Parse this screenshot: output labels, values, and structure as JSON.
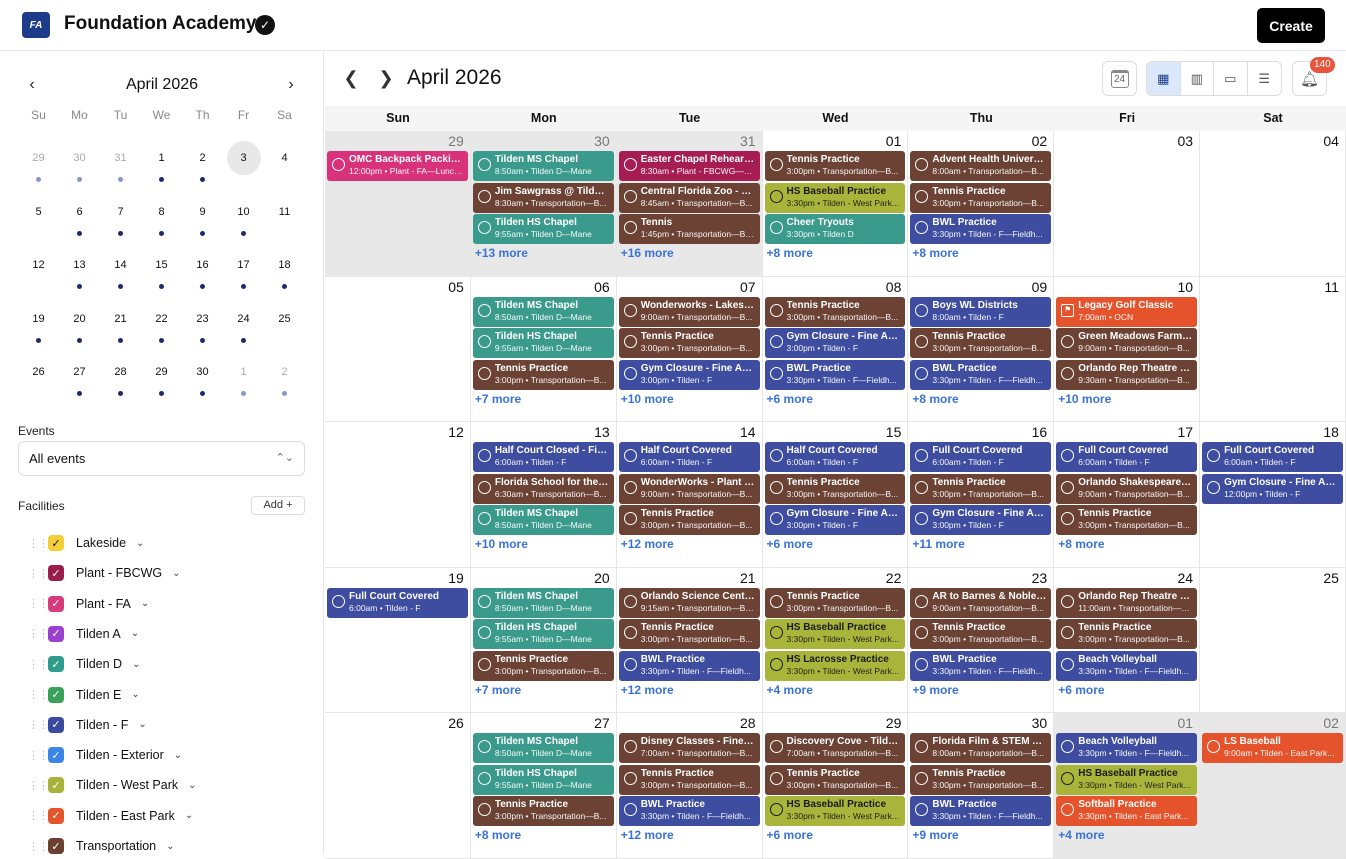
{
  "app": {
    "title": "Foundation Academy",
    "logo_text": "FA",
    "create_label": "Create"
  },
  "sidebar": {
    "month_title": "April 2026",
    "prev": "‹",
    "next": "›",
    "dow": [
      "Su",
      "Mo",
      "Tu",
      "We",
      "Th",
      "Fr",
      "Sa"
    ],
    "weeks": [
      [
        {
          "d": "29",
          "o": true,
          "dot": "light"
        },
        {
          "d": "30",
          "o": true,
          "dot": "light"
        },
        {
          "d": "31",
          "o": true,
          "dot": "light"
        },
        {
          "d": "1",
          "dot": "dark"
        },
        {
          "d": "2",
          "dot": "dark"
        },
        {
          "d": "3",
          "today": true
        },
        {
          "d": "4"
        }
      ],
      [
        {
          "d": "5"
        },
        {
          "d": "6",
          "dot": "dark"
        },
        {
          "d": "7",
          "dot": "dark"
        },
        {
          "d": "8",
          "dot": "dark"
        },
        {
          "d": "9",
          "dot": "dark"
        },
        {
          "d": "10",
          "dot": "dark"
        },
        {
          "d": "11"
        }
      ],
      [
        {
          "d": "12"
        },
        {
          "d": "13",
          "dot": "dark"
        },
        {
          "d": "14",
          "dot": "dark"
        },
        {
          "d": "15",
          "dot": "dark"
        },
        {
          "d": "16",
          "dot": "dark"
        },
        {
          "d": "17",
          "dot": "dark"
        },
        {
          "d": "18",
          "dot": "dark"
        }
      ],
      [
        {
          "d": "19",
          "dot": "dark"
        },
        {
          "d": "20",
          "dot": "dark"
        },
        {
          "d": "21",
          "dot": "dark"
        },
        {
          "d": "22",
          "dot": "dark"
        },
        {
          "d": "23",
          "dot": "dark"
        },
        {
          "d": "24",
          "dot": "dark"
        },
        {
          "d": "25"
        }
      ],
      [
        {
          "d": "26"
        },
        {
          "d": "27",
          "dot": "dark"
        },
        {
          "d": "28",
          "dot": "dark"
        },
        {
          "d": "29",
          "dot": "dark"
        },
        {
          "d": "30",
          "dot": "dark"
        },
        {
          "d": "1",
          "o": true,
          "dot": "light"
        },
        {
          "d": "2",
          "o": true,
          "dot": "light"
        }
      ]
    ],
    "events_label": "Events",
    "events_value": "All events",
    "facilities_label": "Facilities",
    "add_label": "Add +",
    "facilities": [
      {
        "name": "Lakeside",
        "color": "#f3cf3a",
        "dark": true
      },
      {
        "name": "Plant - FBCWG",
        "color": "#9b1b4b"
      },
      {
        "name": "Plant - FA",
        "color": "#d63a7a"
      },
      {
        "name": "Tilden A",
        "color": "#9b3fd1"
      },
      {
        "name": "Tilden D",
        "color": "#2f9b8a"
      },
      {
        "name": "Tilden E",
        "color": "#3aa05a"
      },
      {
        "name": "Tilden - F",
        "color": "#3b4a9e"
      },
      {
        "name": "Tilden - Exterior",
        "color": "#3a86e8"
      },
      {
        "name": "Tilden - West Park",
        "color": "#a7b23a"
      },
      {
        "name": "Tilden - East Park",
        "color": "#e5552b"
      },
      {
        "name": "Transportation",
        "color": "#6a4030"
      }
    ]
  },
  "calendar": {
    "title": "April 2026",
    "today_icon": "24",
    "notif_count": "140",
    "dow": [
      "Sun",
      "Mon",
      "Tue",
      "Wed",
      "Thu",
      "Fri",
      "Sat"
    ],
    "colors": {
      "teal": "#3a9a8c",
      "brown": "#6b4234",
      "blue": "#3e4d9f",
      "olive": "#a9b53a",
      "pink": "#d8337a",
      "maroon": "#a51d52",
      "orange": "#e5532c"
    },
    "weeks": [
      [
        {
          "d": "29",
          "o": true,
          "events": [
            {
              "t": "OMC Backpack Packing ...",
              "s": "12:00pm • Plant - FA—Lunch...",
              "c": "pink"
            }
          ]
        },
        {
          "d": "30",
          "o": true,
          "events": [
            {
              "t": "Tilden MS Chapel",
              "s": "8:50am • Tilden D—Mane",
              "c": "teal"
            },
            {
              "t": "Jim Sawgrass @ Tilden (...",
              "s": "8:30am • Transportation—B...",
              "c": "brown"
            },
            {
              "t": "Tilden HS Chapel",
              "s": "9:55am • Tilden D—Mane",
              "c": "teal"
            }
          ],
          "more": "+13 more"
        },
        {
          "d": "31",
          "o": true,
          "events": [
            {
              "t": "Easter Chapel Rehearsal",
              "s": "8:30am • Plant - FBCWG—S...",
              "c": "maroon"
            },
            {
              "t": "Central Florida Zoo - Plan...",
              "s": "8:45am • Transportation—B...",
              "c": "brown"
            },
            {
              "t": "Tennis",
              "s": "1:45pm • Transportation—Bu...",
              "c": "brown"
            }
          ],
          "more": "+16 more"
        },
        {
          "d": "01",
          "events": [
            {
              "t": "Tennis Practice",
              "s": "3:00pm • Transportation—B...",
              "c": "brown"
            },
            {
              "t": "HS Baseball Practice",
              "s": "3:30pm • Tilden - West Park...",
              "c": "olive",
              "dark": true
            },
            {
              "t": "Cheer Tryouts",
              "s": "3:30pm • Tilden D",
              "c": "teal"
            }
          ],
          "more": "+8 more"
        },
        {
          "d": "02",
          "events": [
            {
              "t": "Advent Health University...",
              "s": "8:00am • Transportation—B...",
              "c": "brown"
            },
            {
              "t": "Tennis Practice",
              "s": "3:00pm • Transportation—B...",
              "c": "brown"
            },
            {
              "t": "BWL Practice",
              "s": "3:30pm • Tilden - F—Fieldh...",
              "c": "blue"
            }
          ],
          "more": "+8 more"
        },
        {
          "d": "03",
          "events": []
        },
        {
          "d": "04",
          "events": []
        }
      ],
      [
        {
          "d": "05",
          "events": []
        },
        {
          "d": "06",
          "events": [
            {
              "t": "Tilden MS Chapel",
              "s": "8:50am • Tilden D—Mane",
              "c": "teal"
            },
            {
              "t": "Tilden HS Chapel",
              "s": "9:55am • Tilden D—Mane",
              "c": "teal"
            },
            {
              "t": "Tennis Practice",
              "s": "3:00pm • Transportation—B...",
              "c": "brown"
            }
          ],
          "more": "+7 more"
        },
        {
          "d": "07",
          "events": [
            {
              "t": "Wonderworks - Lakeside...",
              "s": "9:00am • Transportation—B...",
              "c": "brown"
            },
            {
              "t": "Tennis Practice",
              "s": "3:00pm • Transportation—B...",
              "c": "brown"
            },
            {
              "t": "Gym Closure - Fine Arts ...",
              "s": "3:00pm • Tilden - F",
              "c": "blue"
            }
          ],
          "more": "+10 more"
        },
        {
          "d": "08",
          "events": [
            {
              "t": "Tennis Practice",
              "s": "3:00pm • Transportation—B...",
              "c": "brown"
            },
            {
              "t": "Gym Closure - Fine Arts ...",
              "s": "3:00pm • Tilden - F",
              "c": "blue"
            },
            {
              "t": "BWL Practice",
              "s": "3:30pm • Tilden - F—Fieldh...",
              "c": "blue"
            }
          ],
          "more": "+6 more"
        },
        {
          "d": "09",
          "events": [
            {
              "t": "Boys WL Districts",
              "s": "8:00am • Tilden - F",
              "c": "blue"
            },
            {
              "t": "Tennis Practice",
              "s": "3:00pm • Transportation—B...",
              "c": "brown"
            },
            {
              "t": "BWL Practice",
              "s": "3:30pm • Tilden - F—Fieldh...",
              "c": "blue"
            }
          ],
          "more": "+8 more"
        },
        {
          "d": "10",
          "events": [
            {
              "t": "Legacy Golf Classic",
              "s": "7:00am • OCN",
              "c": "orange",
              "flag": true
            },
            {
              "t": "Green Meadows Farm - L...",
              "s": "9:00am • Transportation—B...",
              "c": "brown"
            },
            {
              "t": "Orlando Rep Theatre - Pl...",
              "s": "9:30am • Transportation—B...",
              "c": "brown"
            }
          ],
          "more": "+10 more"
        },
        {
          "d": "11",
          "events": []
        }
      ],
      [
        {
          "d": "12",
          "events": []
        },
        {
          "d": "13",
          "events": [
            {
              "t": "Half Court Closed - Fine ...",
              "s": "6:00am • Tilden - F",
              "c": "blue"
            },
            {
              "t": "Florida School for the De...",
              "s": "6:30am • Transportation—B...",
              "c": "brown"
            },
            {
              "t": "Tilden MS Chapel",
              "s": "8:50am • Tilden D—Mane",
              "c": "teal"
            }
          ],
          "more": "+10 more"
        },
        {
          "d": "14",
          "events": [
            {
              "t": "Half Court Covered",
              "s": "6:00am • Tilden - F",
              "c": "blue"
            },
            {
              "t": "WonderWorks - Plant Ho...",
              "s": "9:00am • Transportation—B...",
              "c": "brown"
            },
            {
              "t": "Tennis Practice",
              "s": "3:00pm • Transportation—B...",
              "c": "brown"
            }
          ],
          "more": "+12 more"
        },
        {
          "d": "15",
          "events": [
            {
              "t": "Half Court Covered",
              "s": "6:00am • Tilden - F",
              "c": "blue"
            },
            {
              "t": "Tennis Practice",
              "s": "3:00pm • Transportation—B...",
              "c": "brown"
            },
            {
              "t": "Gym Closure - Fine Arts ...",
              "s": "3:00pm • Tilden - F",
              "c": "blue"
            }
          ],
          "more": "+6 more"
        },
        {
          "d": "16",
          "events": [
            {
              "t": "Full Court Covered",
              "s": "6:00am • Tilden - F",
              "c": "blue"
            },
            {
              "t": "Tennis Practice",
              "s": "3:00pm • Transportation—B...",
              "c": "brown"
            },
            {
              "t": "Gym Closure - Fine Arts ...",
              "s": "3:00pm • Tilden - F",
              "c": "blue"
            }
          ],
          "more": "+11 more"
        },
        {
          "d": "17",
          "events": [
            {
              "t": "Full Court Covered",
              "s": "6:00am • Tilden - F",
              "c": "blue"
            },
            {
              "t": "Orlando Shakespeare Th...",
              "s": "9:00am • Transportation—B...",
              "c": "brown"
            },
            {
              "t": "Tennis Practice",
              "s": "3:00pm • Transportation—B...",
              "c": "brown"
            }
          ],
          "more": "+8 more"
        },
        {
          "d": "18",
          "events": [
            {
              "t": "Full Court Covered",
              "s": "6:00am • Tilden - F",
              "c": "blue"
            },
            {
              "t": "Gym Closure - Fine Arts ...",
              "s": "12:00pm • Tilden - F",
              "c": "blue"
            }
          ]
        }
      ],
      [
        {
          "d": "19",
          "events": [
            {
              "t": "Full Court Covered",
              "s": "6:00am • Tilden - F",
              "c": "blue"
            }
          ]
        },
        {
          "d": "20",
          "events": [
            {
              "t": "Tilden MS Chapel",
              "s": "8:50am • Tilden D—Mane",
              "c": "teal"
            },
            {
              "t": "Tilden HS Chapel",
              "s": "9:55am • Tilden D—Mane",
              "c": "teal"
            },
            {
              "t": "Tennis Practice",
              "s": "3:00pm • Transportation—B...",
              "c": "brown"
            }
          ],
          "more": "+7 more"
        },
        {
          "d": "21",
          "events": [
            {
              "t": "Orlando Science Center -...",
              "s": "9:15am • Transportation—Bu...",
              "c": "brown"
            },
            {
              "t": "Tennis Practice",
              "s": "3:00pm • Transportation—B...",
              "c": "brown"
            },
            {
              "t": "BWL Practice",
              "s": "3:30pm • Tilden - F—Fieldh...",
              "c": "blue"
            }
          ],
          "more": "+12 more"
        },
        {
          "d": "22",
          "events": [
            {
              "t": "Tennis Practice",
              "s": "3:00pm • Transportation—B...",
              "c": "brown"
            },
            {
              "t": "HS Baseball Practice",
              "s": "3:30pm • Tilden - West Park...",
              "c": "olive",
              "dark": true
            },
            {
              "t": "HS Lacrosse Practice",
              "s": "3:30pm • Tilden - West Park...",
              "c": "olive",
              "dark": true
            }
          ],
          "more": "+4 more"
        },
        {
          "d": "23",
          "events": [
            {
              "t": "AR to Barnes & Noble an...",
              "s": "9:00am • Transportation—B...",
              "c": "brown"
            },
            {
              "t": "Tennis Practice",
              "s": "3:00pm • Transportation—B...",
              "c": "brown"
            },
            {
              "t": "BWL Practice",
              "s": "3:30pm • Tilden - F—Fieldh...",
              "c": "blue"
            }
          ],
          "more": "+9 more"
        },
        {
          "d": "24",
          "events": [
            {
              "t": "Orlando Rep Theatre - La...",
              "s": "11:00am • Transportation—B...",
              "c": "brown"
            },
            {
              "t": "Tennis Practice",
              "s": "3:00pm • Transportation—B...",
              "c": "brown"
            },
            {
              "t": "Beach Volleyball",
              "s": "3:30pm • Tilden - F—Fieldh...",
              "c": "blue"
            }
          ],
          "more": "+6 more"
        },
        {
          "d": "25",
          "events": []
        }
      ],
      [
        {
          "d": "26",
          "events": []
        },
        {
          "d": "27",
          "events": [
            {
              "t": "Tilden MS Chapel",
              "s": "8:50am • Tilden D—Mane",
              "c": "teal"
            },
            {
              "t": "Tilden HS Chapel",
              "s": "9:55am • Tilden D—Mane",
              "c": "teal"
            },
            {
              "t": "Tennis Practice",
              "s": "3:00pm • Transportation—B...",
              "c": "brown"
            }
          ],
          "more": "+8 more"
        },
        {
          "d": "28",
          "events": [
            {
              "t": "Disney Classes - Fine Arts",
              "s": "7:00am • Transportation—B...",
              "c": "brown"
            },
            {
              "t": "Tennis Practice",
              "s": "3:00pm • Transportation—B...",
              "c": "brown"
            },
            {
              "t": "BWL Practice",
              "s": "3:30pm • Tilden - F—Fieldh...",
              "c": "blue"
            }
          ],
          "more": "+12 more"
        },
        {
          "d": "29",
          "events": [
            {
              "t": "Discovery Cove - Tilden ...",
              "s": "7:00am • Transportation—B...",
              "c": "brown"
            },
            {
              "t": "Tennis Practice",
              "s": "3:00pm • Transportation—B...",
              "c": "brown"
            },
            {
              "t": "HS Baseball Practice",
              "s": "3:30pm • Tilden - West Park...",
              "c": "olive",
              "dark": true
            }
          ],
          "more": "+6 more"
        },
        {
          "d": "30",
          "events": [
            {
              "t": "Florida Film & STEM Aca...",
              "s": "8:00am • Transportation—B...",
              "c": "brown"
            },
            {
              "t": "Tennis Practice",
              "s": "3:00pm • Transportation—B...",
              "c": "brown"
            },
            {
              "t": "BWL Practice",
              "s": "3:30pm • Tilden - F—Fieldh...",
              "c": "blue"
            }
          ],
          "more": "+9 more"
        },
        {
          "d": "01",
          "o": true,
          "events": [
            {
              "t": "Beach Volleyball",
              "s": "3:30pm • Tilden - F—Fieldh...",
              "c": "blue"
            },
            {
              "t": "HS Baseball Practice",
              "s": "3:30pm • Tilden - West Park...",
              "c": "olive",
              "dark": true
            },
            {
              "t": "Softball Practice",
              "s": "3:30pm • Tilden - East Park...",
              "c": "orange"
            }
          ],
          "more": "+4 more"
        },
        {
          "d": "02",
          "o": true,
          "events": [
            {
              "t": "LS Baseball",
              "s": "9:00am • Tilden - East Park...",
              "c": "orange"
            }
          ]
        }
      ]
    ]
  }
}
